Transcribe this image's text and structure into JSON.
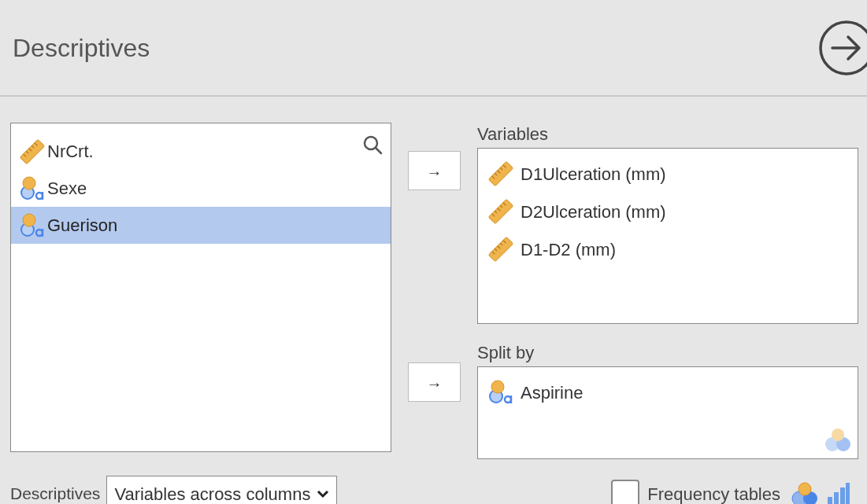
{
  "title": "Descriptives",
  "source_list": {
    "items": [
      {
        "name": "NrCrt.",
        "kind": "continuous",
        "selected": false
      },
      {
        "name": "Sexe",
        "kind": "nominal",
        "selected": false
      },
      {
        "name": "Guerison",
        "kind": "nominal",
        "selected": true
      }
    ]
  },
  "targets": [
    {
      "label": "Variables",
      "items": [
        {
          "name": "D1Ulceration (mm)",
          "kind": "continuous"
        },
        {
          "name": "D2Ulceration (mm)",
          "kind": "continuous"
        },
        {
          "name": "D1-D2 (mm)",
          "kind": "continuous"
        }
      ]
    },
    {
      "label": "Split by",
      "items": [
        {
          "name": "Aspirine",
          "kind": "nominal"
        }
      ],
      "accepts_icon": true
    }
  ],
  "move_buttons": [
    "→",
    "→"
  ],
  "layout": {
    "label": "Descriptives",
    "value": "Variables across columns"
  },
  "frequency_tables": {
    "label": "Frequency tables",
    "checked": false
  }
}
